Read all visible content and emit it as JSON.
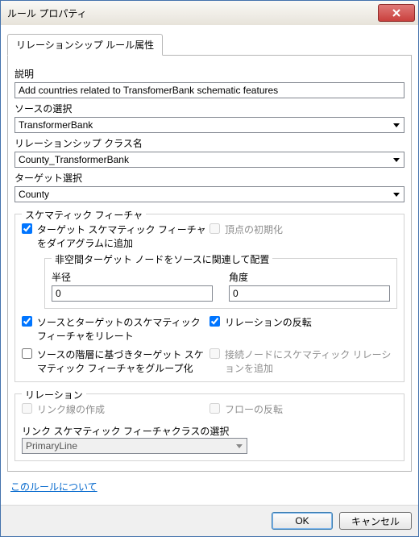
{
  "window": {
    "title": "ルール プロパティ"
  },
  "tabs": {
    "t0": "リレーションシップ ルール属性"
  },
  "labels": {
    "desc": "説明",
    "sourceSel": "ソースの選択",
    "relClass": "リレーションシップ クラス名",
    "targetSel": "ターゲット選択"
  },
  "values": {
    "desc": "Add countries related to TransfomerBank schematic features",
    "source": "TransformerBank",
    "relclass": "County_TransformerBank",
    "target": "County"
  },
  "schematic": {
    "title": "スケマティック フィーチャ",
    "addTarget": "ターゲット スケマティック フィーチャをダイアグラムに追加",
    "vertexInit": "頂点の初期化",
    "innerTitle": "非空間ターゲット ノードをソースに関連して配置",
    "radiusLbl": "半径",
    "angleLbl": "角度",
    "radiusVal": "0",
    "angleVal": "0",
    "relateSchem": "ソースとターゲットのスケマティック フィーチャをリレート",
    "reverse": "リレーションの反転",
    "groupHier": "ソースの階層に基づきターゲット スケマティック フィーチャをグループ化",
    "addConnNode": "接続ノードにスケマティック リレーションを追加"
  },
  "relation": {
    "title": "リレーション",
    "createLinks": "リンク線の作成",
    "reverseFlow": "フローの反転",
    "linkClassLbl": "リンク スケマティック フィーチャクラスの選択",
    "linkClassVal": "PrimaryLine"
  },
  "link": "このルールについて",
  "buttons": {
    "ok": "OK",
    "cancel": "キャンセル"
  }
}
